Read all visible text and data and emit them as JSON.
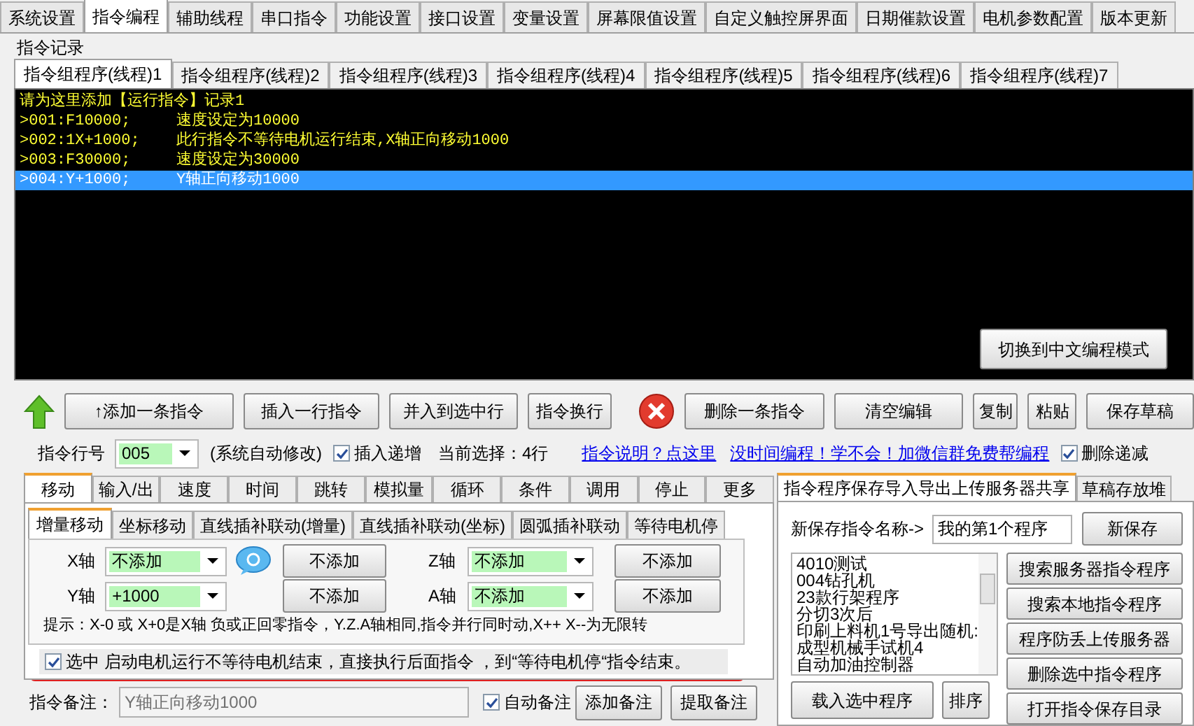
{
  "top_tabs": [
    {
      "label": "系统设置",
      "selected": false
    },
    {
      "label": "指令编程",
      "selected": true
    },
    {
      "label": "辅助线程",
      "selected": false
    },
    {
      "label": "串口指令",
      "selected": false
    },
    {
      "label": "功能设置",
      "selected": false
    },
    {
      "label": "接口设置",
      "selected": false
    },
    {
      "label": "变量设置",
      "selected": false
    },
    {
      "label": "屏幕限值设置",
      "selected": false
    },
    {
      "label": "自定义触控屏界面",
      "selected": false
    },
    {
      "label": "日期催款设置",
      "selected": false
    },
    {
      "label": "电机参数配置",
      "selected": false
    },
    {
      "label": "版本更新",
      "selected": false
    }
  ],
  "record_group": {
    "title": "指令记录",
    "program_tabs": [
      {
        "label": "指令组程序(线程)1",
        "selected": true
      },
      {
        "label": "指令组程序(线程)2",
        "selected": false
      },
      {
        "label": "指令组程序(线程)3",
        "selected": false
      },
      {
        "label": "指令组程序(线程)4",
        "selected": false
      },
      {
        "label": "指令组程序(线程)5",
        "selected": false
      },
      {
        "label": "指令组程序(线程)6",
        "selected": false
      },
      {
        "label": "指令组程序(线程)7",
        "selected": false
      }
    ],
    "lines": [
      {
        "code": "请为这里添加【运行指令】记录1",
        "selected": false
      },
      {
        "code": ">001:F10000;",
        "comment": "速度设定为10000",
        "selected": false
      },
      {
        "code": ">002:1X+1000;",
        "comment": "此行指令不等待电机运行结束,X轴正向移动1000",
        "selected": false
      },
      {
        "code": ">003:F30000;",
        "comment": "速度设定为30000",
        "selected": false
      },
      {
        "code": ">004:Y+1000;",
        "comment": "Y轴正向移动1000",
        "selected": true
      }
    ],
    "switch_button": "切换到中文编程模式"
  },
  "toolbar": {
    "add_buttons": [
      "↑添加一条指令",
      "插入一行指令",
      "并入到选中行",
      "指令换行"
    ],
    "edit_buttons": [
      "删除一条指令",
      "清空编辑",
      "复制",
      "粘贴",
      "保存草稿"
    ]
  },
  "line_row": {
    "label": "指令行号",
    "value": "005",
    "note": "(系统自动修改)",
    "insert_increment": {
      "label": "插入递增",
      "checked": true
    },
    "current_selection": "当前选择：4行",
    "links": [
      "指令说明？点这里",
      "没时间编程！学不会！加微信群免费帮编程"
    ],
    "delete_decrement": {
      "label": "删除递减",
      "checked": true
    }
  },
  "command_panel": {
    "tabs": [
      {
        "label": "移动",
        "selected": true
      },
      {
        "label": "输入/出",
        "selected": false
      },
      {
        "label": "速度",
        "selected": false
      },
      {
        "label": "时间",
        "selected": false
      },
      {
        "label": "跳转",
        "selected": false
      },
      {
        "label": "模拟量",
        "selected": false
      },
      {
        "label": "循环",
        "selected": false
      },
      {
        "label": "条件",
        "selected": false
      },
      {
        "label": "调用",
        "selected": false
      },
      {
        "label": "停止",
        "selected": false
      },
      {
        "label": "更多",
        "selected": false
      }
    ],
    "subtabs": [
      {
        "label": "增量移动",
        "selected": true
      },
      {
        "label": "坐标移动",
        "selected": false
      },
      {
        "label": "直线插补联动(增量)",
        "selected": false
      },
      {
        "label": "直线插补联动(坐标)",
        "selected": false
      },
      {
        "label": "圆弧插补联动",
        "selected": false
      },
      {
        "label": "等待电机停",
        "selected": false
      }
    ],
    "axes": [
      {
        "label": "X轴",
        "value": "不添加",
        "button": "不添加"
      },
      {
        "label": "Z轴",
        "value": "不添加",
        "button": "不添加"
      },
      {
        "label": "Y轴",
        "value": "+1000",
        "button": "不添加"
      },
      {
        "label": "A轴",
        "value": "不添加",
        "button": "不添加"
      }
    ],
    "hint": "提示：X-0 或 X+0是X轴 负或正回零指令，Y.Z.A轴相同,指令并行同时动,X++ X--为无限转",
    "no_wait": {
      "label": "选中 启动电机运行不等待电机结束，直接执行后面指令 ，到“等待电机停“指令结束。",
      "checked": true
    },
    "remark": {
      "label": "指令备注：",
      "value": "Y轴正向移动1000",
      "auto": {
        "label": "自动备注",
        "checked": true
      },
      "buttons": [
        "添加备注",
        "提取备注"
      ]
    }
  },
  "save_panel": {
    "tabs": [
      {
        "label": "指令程序保存导入导出上传服务器共享",
        "selected": true
      },
      {
        "label": "草稿存放堆",
        "selected": false
      }
    ],
    "name_label": "新保存指令名称->",
    "name_value": "我的第1个程序",
    "save_button": "新保存",
    "programs": [
      "4010测试",
      "004钻孔机",
      "23款行架程序",
      "分切3次后",
      "印刷上料机1号导出随机:",
      "成型机械手试机4",
      "自动加油控制器"
    ],
    "action_buttons": [
      "搜索服务器指令程序",
      "搜索本地指令程序",
      "程序防丢上传服务器",
      "删除选中指令程序",
      "打开指令保存目录"
    ],
    "load_button": "载入选中程序",
    "sort_button": "排序"
  }
}
